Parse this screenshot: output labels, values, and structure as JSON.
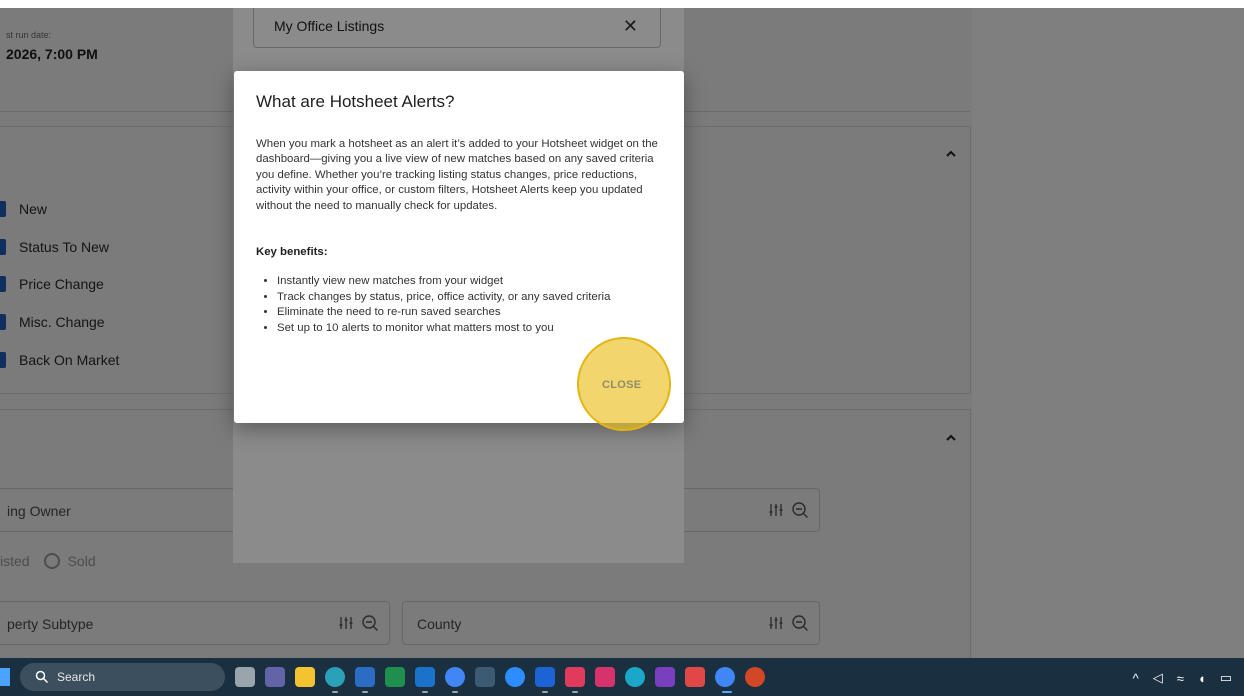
{
  "background": {
    "last_run_label": "st run date:",
    "last_run_value": "2026, 7:00 PM",
    "status_checkboxes": [
      "New",
      "Status To New",
      "Price Change",
      "Misc. Change",
      "Back On Market"
    ],
    "field_listing_owner": "ing Owner",
    "radio_listed": "isted",
    "radio_sold": "Sold",
    "field_property_subtype": "perty Subtype",
    "field_county": "County"
  },
  "hotsheet_dialog": {
    "name_value": "My Office Listings",
    "clear_icon": "close-icon"
  },
  "modal": {
    "title": "What are Hotsheet Alerts?",
    "description": "When you mark a hotsheet as an alert it’s added to your Hotsheet widget on the dashboard—giving you a live view of new matches based on any saved criteria you define. Whether you’re tracking listing status changes, price reductions, activity within your office, or custom filters, Hotsheet Alerts keep you updated without the need to manually check for updates.",
    "key_benefits_heading": "Key benefits:",
    "benefits": [
      "Instantly view new matches from your widget",
      "Track changes by status, price, office activity, or any saved criteria",
      "Eliminate the need to re-run saved searches",
      "Set up to 10 alerts to monitor what matters most to you"
    ],
    "close_label": "CLOSE",
    "highlight_color": "#ecc328"
  },
  "taskbar": {
    "search_placeholder": "Search",
    "apps": [
      "widgets-icon",
      "teams-icon",
      "file-explorer-icon",
      "edge-icon",
      "word-icon",
      "excel-icon",
      "outlook-icon",
      "chrome-icon",
      "calculator-icon",
      "zoom-icon",
      "remine-icon",
      "snip-icon",
      "app-icon",
      "canva-icon",
      "onenote-icon",
      "scribe-icon",
      "chrome-profile-icon",
      "powerpoint-icon"
    ]
  },
  "colors": {
    "accent_blue": "#1f5fbf",
    "taskbar_bg": "#1a2f3f"
  }
}
